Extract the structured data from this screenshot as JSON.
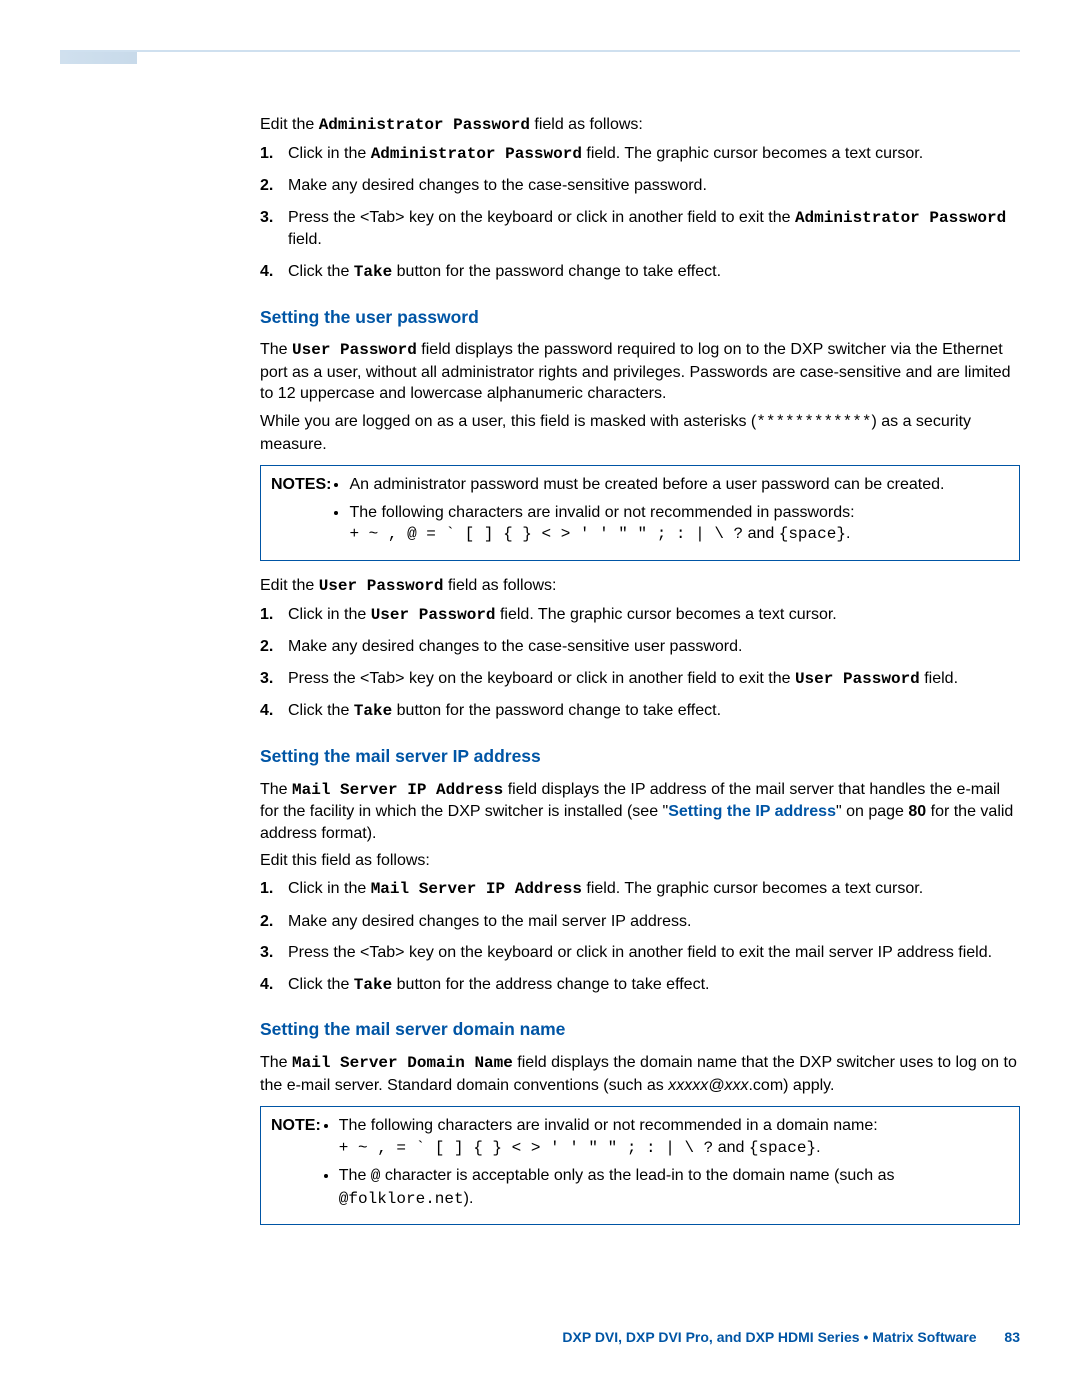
{
  "section1": {
    "intro_before": "Edit the ",
    "intro_code": "Administrator Password",
    "intro_after": " field as follows:",
    "steps": {
      "s1_a": "Click in the ",
      "s1_code": "Administrator Password",
      "s1_b": " field. The graphic cursor becomes a text cursor.",
      "s2": "Make any desired changes to the case-sensitive password.",
      "s3_a": "Press the <Tab> key on the keyboard or click in another field to exit the ",
      "s3_code": "Administrator Password",
      "s3_b": " field.",
      "s4_a": "Click the ",
      "s4_code": "Take",
      "s4_b": " button for the password change to take effect."
    }
  },
  "section2": {
    "heading": "Setting the user password",
    "p1_a": "The ",
    "p1_code": "User Password",
    "p1_b": " field displays the password required to log on to the DXP switcher via the Ethernet port as a user, without all administrator rights and privileges. Passwords are case-sensitive and are limited to 12 uppercase and lowercase alphanumeric characters.",
    "p2_a": "While you are logged on as a user, this field is masked with asterisks (",
    "p2_code": "************",
    "p2_b": ") as a security measure.",
    "note_label": "NOTES:",
    "note_b1": "An administrator password must be created before a user password can be created.",
    "note_b2": "The following characters are invalid or not recommended in passwords:",
    "note_chars": "+ ~ , @ = ` [ ] { } < > ' ' \" \" ; : | \\ ?",
    "note_and": " and ",
    "note_space": "{space}",
    "period": ".",
    "intro_before": "Edit the ",
    "intro_code": "User Password",
    "intro_after": " field as follows:",
    "steps": {
      "s1_a": "Click in the ",
      "s1_code": "User Password",
      "s1_b": " field. The graphic cursor becomes a text cursor.",
      "s2": "Make any desired changes to the case-sensitive user password.",
      "s3_a": "Press the <Tab> key on the keyboard or click in another field to exit the ",
      "s3_code": "User Password",
      "s3_b": " field.",
      "s4_a": "Click the ",
      "s4_code": "Take",
      "s4_b": " button for the password change to take effect."
    }
  },
  "section3": {
    "heading": "Setting the mail server IP address",
    "p1_a": "The ",
    "p1_code": "Mail Server IP Address",
    "p1_b": " field displays the IP address of the mail server that handles the e-mail for the facility in which the DXP switcher is installed (see \"",
    "p1_link": "Setting the IP address",
    "p1_c": "\" on page ",
    "p1_page": "80",
    "p1_d": " for the valid address format).",
    "p2": "Edit this field as follows:",
    "steps": {
      "s1_a": "Click in the ",
      "s1_code": "Mail Server IP Address",
      "s1_b": " field. The graphic cursor becomes a text cursor.",
      "s2": "Make any desired changes to the mail server IP address.",
      "s3": "Press the <Tab> key on the keyboard or click in another field to exit the mail server IP address field.",
      "s4_a": "Click the ",
      "s4_code": "Take",
      "s4_b": " button for the address change to take effect."
    }
  },
  "section4": {
    "heading": "Setting the mail server domain name",
    "p1_a": "The ",
    "p1_code": "Mail Server Domain Name",
    "p1_b": " field displays the domain name that the DXP switcher uses to log on to the e-mail server. Standard domain conventions (such as ",
    "p1_italic": "xxxxx@xxx",
    "p1_c": ".com) apply.",
    "note_label": "NOTE:",
    "note_b1": "The following characters are invalid or not recommended in a domain name:",
    "note_chars": "+ ~ , = ` [ ] { } < > ' ' \" \" ; : | \\ ?",
    "note_and": " and ",
    "note_space": "{space}",
    "period": ".",
    "note_b2_a": "The ",
    "note_b2_code": "@",
    "note_b2_b": " character is acceptable only as the lead-in to the domain name (such as ",
    "note_b2_code2": "@folklore.net",
    "note_b2_c": ")."
  },
  "footer": {
    "text": "DXP DVI, DXP DVI Pro, and DXP HDMI Series • Matrix Software",
    "page": "83"
  },
  "nums": {
    "n1": "1.",
    "n2": "2.",
    "n3": "3.",
    "n4": "4."
  }
}
